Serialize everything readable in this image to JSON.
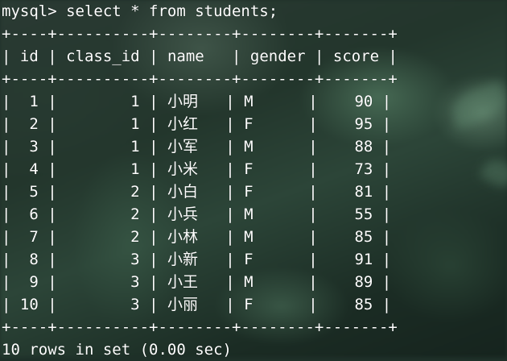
{
  "prompt": "mysql> select * from students;",
  "border": "+----+----------+--------+--------+-------+",
  "header": {
    "id": "id",
    "class_id": "class_id",
    "name": "name",
    "gender": "gender",
    "score": "score"
  },
  "rows": [
    {
      "id": "1",
      "class_id": "1",
      "name": "小明",
      "gender": "M",
      "score": "90"
    },
    {
      "id": "2",
      "class_id": "1",
      "name": "小红",
      "gender": "F",
      "score": "95"
    },
    {
      "id": "3",
      "class_id": "1",
      "name": "小军",
      "gender": "M",
      "score": "88"
    },
    {
      "id": "4",
      "class_id": "1",
      "name": "小米",
      "gender": "F",
      "score": "73"
    },
    {
      "id": "5",
      "class_id": "2",
      "name": "小白",
      "gender": "F",
      "score": "81"
    },
    {
      "id": "6",
      "class_id": "2",
      "name": "小兵",
      "gender": "M",
      "score": "55"
    },
    {
      "id": "7",
      "class_id": "2",
      "name": "小林",
      "gender": "M",
      "score": "85"
    },
    {
      "id": "8",
      "class_id": "3",
      "name": "小新",
      "gender": "F",
      "score": "91"
    },
    {
      "id": "9",
      "class_id": "3",
      "name": "小王",
      "gender": "M",
      "score": "89"
    },
    {
      "id": "10",
      "class_id": "3",
      "name": "小丽",
      "gender": "F",
      "score": "85"
    }
  ],
  "footer": "10 rows in set (0.00 sec)",
  "colors": {
    "text": "#ffffff",
    "background": "#1f3029"
  }
}
